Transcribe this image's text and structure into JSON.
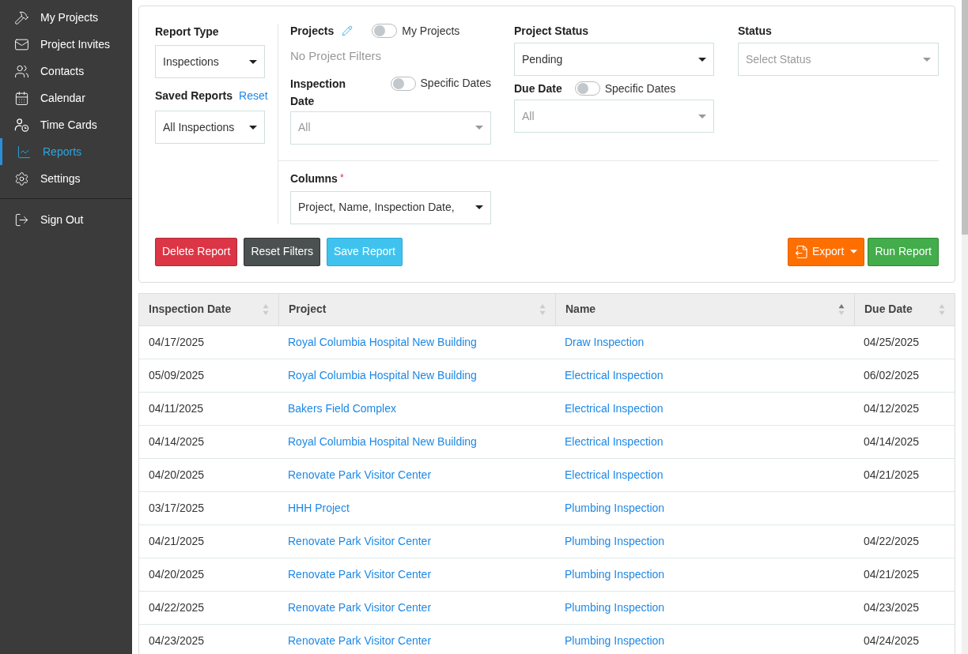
{
  "sidebar": {
    "items": [
      {
        "label": "My Projects",
        "selected": false
      },
      {
        "label": "Project Invites",
        "selected": false
      },
      {
        "label": "Contacts",
        "selected": false
      },
      {
        "label": "Calendar",
        "selected": false
      },
      {
        "label": "Time Cards",
        "selected": false
      },
      {
        "label": "Reports",
        "selected": true
      },
      {
        "label": "Settings",
        "selected": false
      }
    ],
    "footer_items": [
      {
        "label": "Sign Out",
        "selected": false
      }
    ]
  },
  "filters": {
    "report_type": {
      "label": "Report Type",
      "value": "Inspections"
    },
    "saved_reports": {
      "label": "Saved Reports",
      "link": "Reset",
      "value": "All Inspections"
    },
    "projects": {
      "label": "Projects",
      "toggle_label": "My Projects",
      "on": false,
      "note": "No Project Filters"
    },
    "inspection_date": {
      "label": "Inspection Date",
      "toggle_label": "Specific Dates",
      "on": false,
      "placeholder": "All"
    },
    "project_status": {
      "label": "Project Status",
      "value": "Pending"
    },
    "due_date": {
      "label": "Due Date",
      "toggle_label": "Specific Dates",
      "on": false,
      "placeholder": "All"
    },
    "status": {
      "label": "Status",
      "placeholder": "Select Status"
    },
    "columns": {
      "label": "Columns",
      "required_mark": "*",
      "value": "Project, Name, Inspection Date,"
    }
  },
  "buttons": [
    {
      "label": "Delete Report",
      "kind": "danger"
    },
    {
      "label": "Reset Filters",
      "kind": "dark"
    },
    {
      "label": "Save Report",
      "kind": "info"
    },
    {
      "label": "Export",
      "kind": "export"
    },
    {
      "label": "Run Report",
      "kind": "success"
    }
  ],
  "table": {
    "columns": [
      {
        "label": "Inspection Date",
        "sorted": false
      },
      {
        "label": "Project",
        "sorted": false
      },
      {
        "label": "Name",
        "sorted": true
      },
      {
        "label": "Due Date",
        "sorted": false
      }
    ],
    "rows": [
      [
        "04/17/2025",
        "Royal Columbia Hospital New Building",
        "Draw Inspection",
        "04/25/2025"
      ],
      [
        "05/09/2025",
        "Royal Columbia Hospital New Building",
        "Electrical Inspection",
        "06/02/2025"
      ],
      [
        "04/11/2025",
        "Bakers Field Complex",
        "Electrical Inspection",
        "04/12/2025"
      ],
      [
        "04/14/2025",
        "Royal Columbia Hospital New Building",
        "Electrical Inspection",
        "04/14/2025"
      ],
      [
        "04/20/2025",
        "Renovate Park Visitor Center",
        "Electrical Inspection",
        "04/21/2025"
      ],
      [
        "03/17/2025",
        "HHH Project",
        "Plumbing Inspection",
        ""
      ],
      [
        "04/21/2025",
        "Renovate Park Visitor Center",
        "Plumbing Inspection",
        "04/22/2025"
      ],
      [
        "04/20/2025",
        "Renovate Park Visitor Center",
        "Plumbing Inspection",
        "04/21/2025"
      ],
      [
        "04/22/2025",
        "Renovate Park Visitor Center",
        "Plumbing Inspection",
        "04/23/2025"
      ],
      [
        "04/23/2025",
        "Renovate Park Visitor Center",
        "Plumbing Inspection",
        "04/24/2025"
      ]
    ]
  }
}
